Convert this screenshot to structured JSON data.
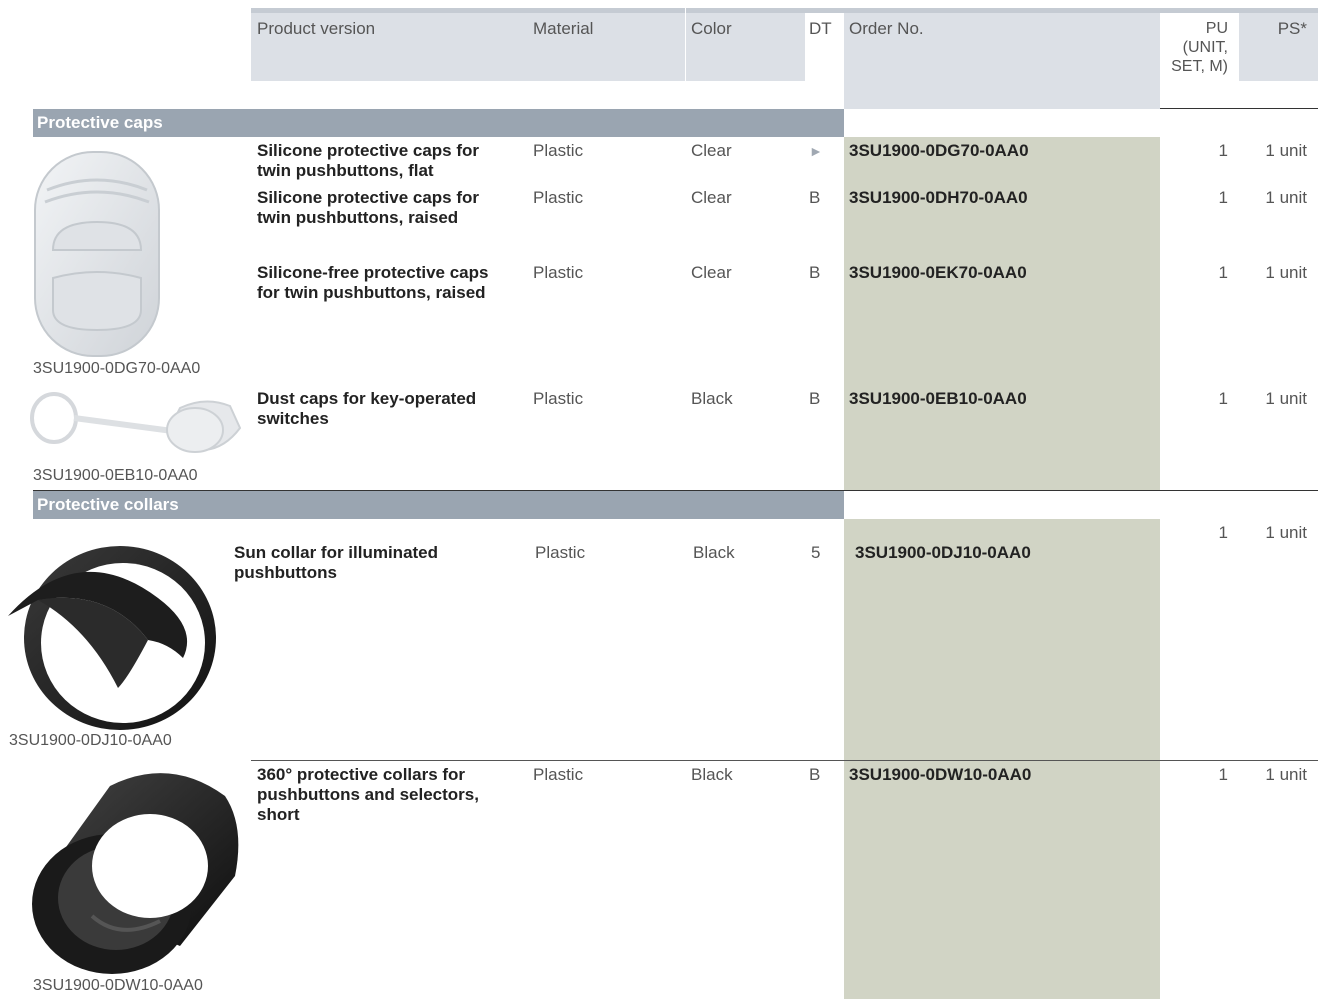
{
  "header": {
    "product_version": "Product version",
    "material": "Material",
    "color": "Color",
    "dt": "DT",
    "order_no": "Order No.",
    "pu_line1": "PU",
    "pu_line2": "(UNIT,",
    "pu_line3": "SET, M)",
    "ps": "PS*"
  },
  "sections": [
    {
      "title": "Protective caps"
    },
    {
      "title": "Protective collars"
    }
  ],
  "rows": [
    {
      "product_line1": "Silicone protective caps for",
      "product_line2": "twin pushbuttons, flat",
      "material": "Plastic",
      "color": "Clear",
      "dt": "►",
      "order_no": "3SU1900-0DG70-0AA0",
      "pu": "1",
      "ps": "1 unit"
    },
    {
      "product_line1": "Silicone protective caps for",
      "product_line2": "twin pushbuttons, raised",
      "material": "Plastic",
      "color": "Clear",
      "dt": "B",
      "order_no": "3SU1900-0DH70-0AA0",
      "pu": "1",
      "ps": "1 unit"
    },
    {
      "product_line1": "Silicone-free protective caps",
      "product_line2": "for twin pushbuttons, raised",
      "material": "Plastic",
      "color": "Clear",
      "dt": "B",
      "order_no": "3SU1900-0EK70-0AA0",
      "pu": "1",
      "ps": "1 unit"
    },
    {
      "product_line1": "Dust caps for key-operated",
      "product_line2": "switches",
      "material": "Plastic",
      "color": "Black",
      "dt": "B",
      "order_no": "3SU1900-0EB10-0AA0",
      "pu": "1",
      "ps": "1 unit"
    },
    {
      "product_line1": "Sun collar for illuminated",
      "product_line2": "pushbuttons",
      "material": "Plastic",
      "color": "Black",
      "dt": "5",
      "order_no": "3SU1900-0DJ10-0AA0",
      "pu": "1",
      "ps": "1 unit"
    },
    {
      "product_line1": "360° protective collars for",
      "product_line2": "pushbuttons and selectors,",
      "product_line3": "short",
      "material": "Plastic",
      "color": "Black",
      "dt": "B",
      "order_no": "3SU1900-0DW10-0AA0",
      "pu": "1",
      "ps": "1 unit"
    }
  ],
  "images": [
    {
      "caption": "3SU1900-0DG70-0AA0",
      "icon": "twin-cap-icon"
    },
    {
      "caption": "3SU1900-0EB10-0AA0",
      "icon": "dust-cap-icon"
    },
    {
      "caption": "3SU1900-0DJ10-0AA0",
      "icon": "sun-collar-icon"
    },
    {
      "caption": "3SU1900-0DW10-0AA0",
      "icon": "round-collar-icon"
    }
  ],
  "colors": {
    "header_bg": "#dce0e6",
    "section_bar": "#9aa5b1",
    "order_column": "#d1d4c5"
  }
}
